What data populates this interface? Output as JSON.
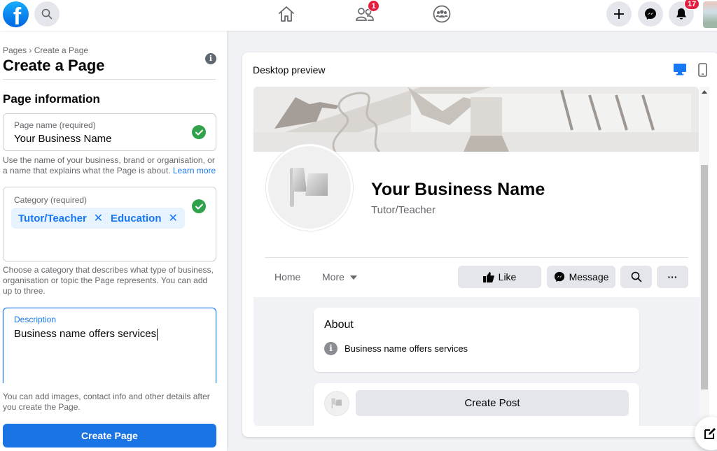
{
  "topbar": {
    "logo_letter": "f",
    "friends_badge": "1",
    "notifications_badge": "17"
  },
  "left_panel": {
    "breadcrumb": "Pages › Create a Page",
    "title": "Create a Page",
    "info_icon": "i",
    "section_title": "Page information",
    "page_name": {
      "label": "Page name (required)",
      "value": "Your Business Name",
      "hint_text": "Use the name of your business, brand or organisation, or a name that explains what the Page is about.",
      "hint_link": "Learn more"
    },
    "category": {
      "label": "Category (required)",
      "chips": [
        {
          "label": "Tutor/Teacher",
          "remove": "✕"
        },
        {
          "label": "Education",
          "remove": "✕"
        }
      ],
      "hint_text": "Choose a category that describes what type of business, organisation or topic the Page represents. You can add up to three."
    },
    "description": {
      "label": "Description",
      "value": "Business name offers services"
    },
    "footer_hint": "You can add images, contact info and other details after you create the Page.",
    "create_button": "Create Page"
  },
  "preview": {
    "title": "Desktop preview",
    "page_name": "Your Business Name",
    "page_category": "Tutor/Teacher",
    "tabs": [
      "Home",
      "More"
    ],
    "actions": {
      "like": "Like",
      "message": "Message",
      "more": "···"
    },
    "about": {
      "title": "About",
      "info_icon": "i",
      "text": "Business name offers services"
    },
    "create_post": "Create Post"
  },
  "colors": {
    "brand_blue": "#1877f2",
    "success_green": "#31a24c",
    "badge_red": "#e41e3f"
  }
}
